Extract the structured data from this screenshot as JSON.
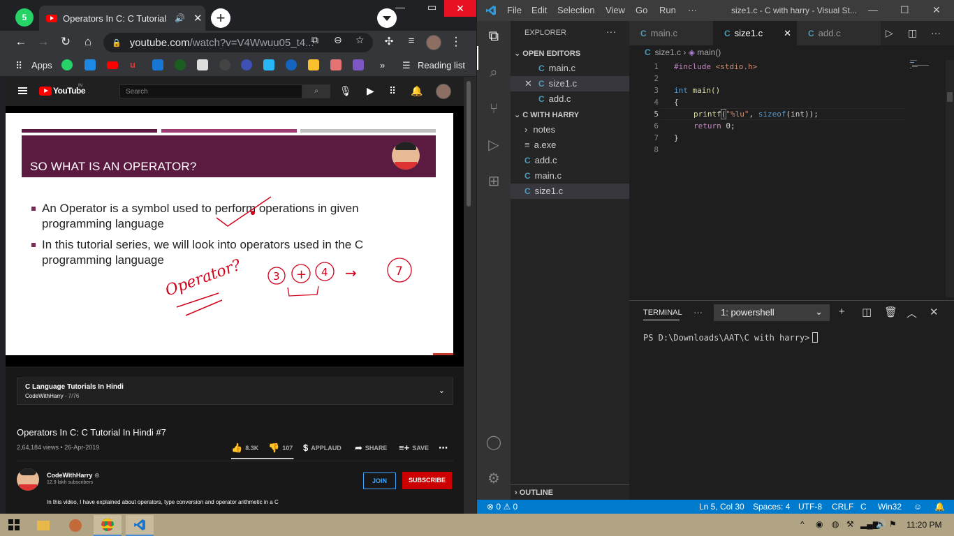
{
  "chrome": {
    "pinned_tab_badge": "5",
    "tab_title": "Operators In C: C Tutorial In Hindi #7",
    "omnibox": {
      "url_host": "youtube.com",
      "url_path": "/watch?v=V4Wwuu05_t4..."
    },
    "bookmarks": {
      "apps_label": "Apps",
      "more": "»",
      "reading_list_label": "Reading list"
    }
  },
  "youtube": {
    "logo_text": "YouTube",
    "logo_region": "IN",
    "search_placeholder": "Search",
    "slide": {
      "title": "SO WHAT IS AN OPERATOR?",
      "bullets": [
        "An Operator is a symbol used to perform operations in given programming language",
        "In this tutorial series, we will look into operators used in the C programming language"
      ],
      "stripe_colors": [
        "#5b1a40",
        "#9b3d73",
        "#bfbfbf"
      ],
      "header_color": "#5b1a40",
      "handwriting": {
        "word": "Operator?",
        "equation": [
          "3",
          "+",
          "4",
          "→",
          "7"
        ]
      }
    },
    "playlist": {
      "title": "C Language Tutorials In Hindi",
      "channel": "CodeWithHarry",
      "position": "7/76"
    },
    "video": {
      "title": "Operators In C: C Tutorial In Hindi #7",
      "views_date": "2,64,184 views • 26-Apr-2019",
      "likes": "8.3K",
      "dislikes": "107",
      "applaud_label": "APPLAUD",
      "share_label": "SHARE",
      "save_label": "SAVE",
      "like_ratio": 0.987
    },
    "channel": {
      "name": "CodeWithHarry",
      "subscribers": "12.9 lakh subscribers",
      "join_label": "JOIN",
      "subscribe_label": "SUBSCRIBE"
    },
    "description": "In this video, I have explained about operators, type conversion and operator arithmetic in a C"
  },
  "vscode": {
    "menu": [
      "File",
      "Edit",
      "Selection",
      "View",
      "Go",
      "Run",
      "···"
    ],
    "window_title": "size1.c - C with harry - Visual St...",
    "explorer_title": "EXPLORER",
    "open_editors_label": "OPEN EDITORS",
    "open_editors": [
      "main.c",
      "size1.c",
      "add.c"
    ],
    "folder_label": "C WITH HARRY",
    "files": [
      {
        "name": "notes",
        "icon": "folder-icon"
      },
      {
        "name": "a.exe",
        "icon": "file-lines-icon"
      },
      {
        "name": "add.c",
        "icon": "c-file-icon"
      },
      {
        "name": "main.c",
        "icon": "c-file-icon"
      },
      {
        "name": "size1.c",
        "icon": "c-file-icon"
      }
    ],
    "outline_label": "OUTLINE",
    "tabs": [
      "main.c",
      "size1.c",
      "add.c"
    ],
    "breadcrumb": {
      "file": "size1.c",
      "symbol": "main()"
    },
    "code_lines": [
      "1",
      "2",
      "3",
      "4",
      "5",
      "6",
      "7",
      "8"
    ],
    "code": {
      "l1_kw": "#include",
      "l1_hdr": "<stdio.h>",
      "l3_type": "int",
      "l3_fn": "main()",
      "l4": "{",
      "l5_fn": "printf",
      "l5_open": "(",
      "l5_str": "\"%lu\"",
      "l5_comma": ", ",
      "l5_kw": "sizeof",
      "l5_arg": "(int)",
      "l5_end": ");",
      "l6_kw": "return",
      "l6_rest": " 0;",
      "l7": "}"
    },
    "terminal": {
      "tab_label": "TERMINAL",
      "shell": "1: powershell",
      "prompt": "PS D:\\Downloads\\AAT\\C with harry>"
    },
    "status": {
      "errors": "0",
      "warnings": "0",
      "cursor": "Ln 5, Col 30",
      "spaces": "Spaces: 4",
      "encoding": "UTF-8",
      "eol": "CRLF",
      "language": "C",
      "platform": "Win32"
    },
    "accent": "#007acc"
  },
  "taskbar": {
    "time": "11:20 PM"
  }
}
